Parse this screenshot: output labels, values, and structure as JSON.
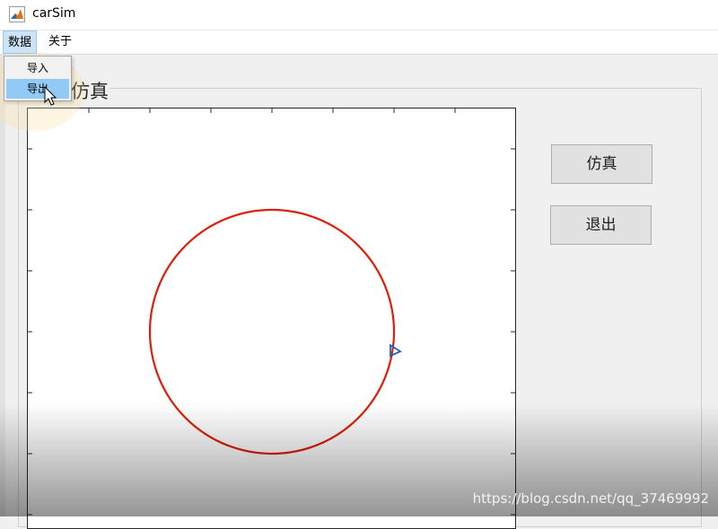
{
  "window": {
    "title": "carSim"
  },
  "menubar": {
    "items": [
      {
        "label": "数据"
      },
      {
        "label": "关于"
      }
    ]
  },
  "dropdown": {
    "items": [
      {
        "label": "导入"
      },
      {
        "label": "导出"
      }
    ],
    "highlighted": "导出"
  },
  "panel": {
    "title": "仿真"
  },
  "buttons": {
    "simulate": "仿真",
    "exit": "退出"
  },
  "plot": {
    "circle_color": "#dd1f0a",
    "car_marker_color": "#1f5fbf",
    "axes_color": "#262626"
  },
  "watermark": "https://blog.csdn.net/qq_37469992",
  "icons": {
    "app": "matlab-app-icon",
    "cursor": "mouse-pointer-icon"
  }
}
